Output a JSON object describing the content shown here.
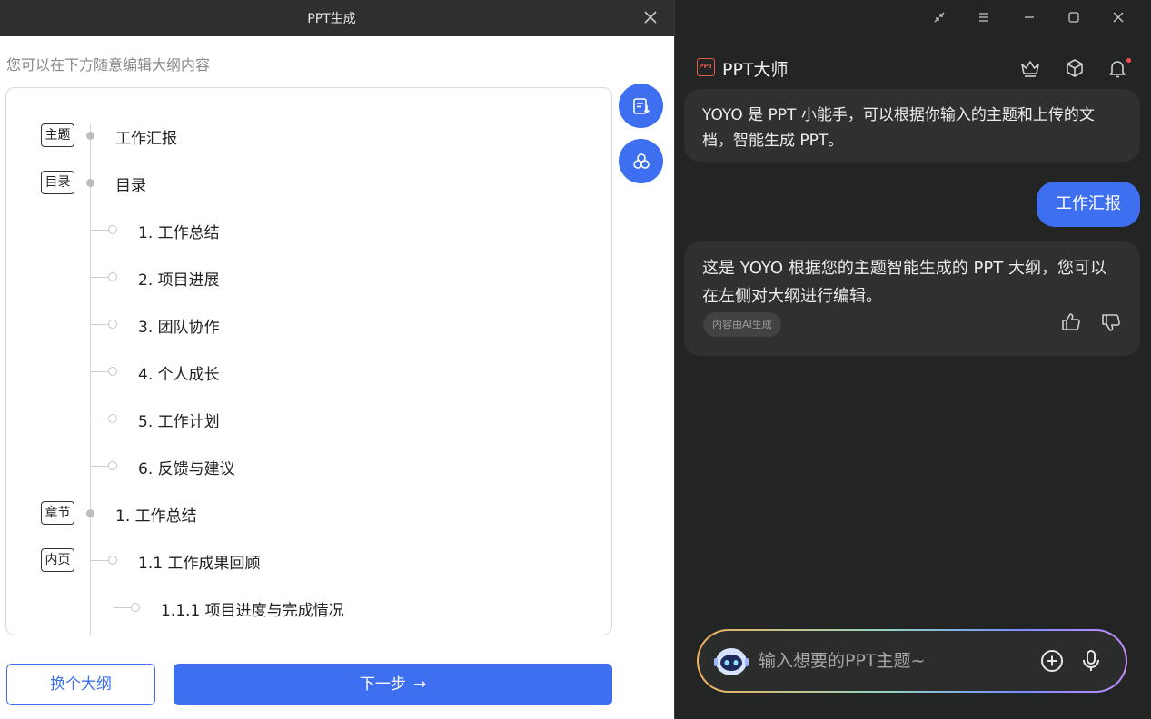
{
  "dialog": {
    "title": "PPT生成",
    "hint": "您可以在下方随意编辑大纲内容",
    "outline": [
      {
        "tag": "主题",
        "text": "工作汇报",
        "level": 0
      },
      {
        "tag": "目录",
        "text": "目录",
        "level": 0
      },
      {
        "tag": "",
        "text": "1. 工作总结",
        "level": 1
      },
      {
        "tag": "",
        "text": "2. 项目进展",
        "level": 1
      },
      {
        "tag": "",
        "text": "3. 团队协作",
        "level": 1
      },
      {
        "tag": "",
        "text": "4. 个人成长",
        "level": 1
      },
      {
        "tag": "",
        "text": "5. 工作计划",
        "level": 1
      },
      {
        "tag": "",
        "text": "6. 反馈与建议",
        "level": 1
      },
      {
        "tag": "章节",
        "text": "1. 工作总结",
        "level": 0
      },
      {
        "tag": "内页",
        "text": "1.1 工作成果回顾",
        "level": 1
      },
      {
        "tag": "",
        "text": "1.1.1 项目进度与完成情况",
        "level": 2
      }
    ],
    "change_button": "换个大纲",
    "next_button": "下一步",
    "next_arrow": "→",
    "accent_color": "#3d6ff0"
  },
  "assistant": {
    "app_name": "PPT大师",
    "logo_text": "PPT",
    "messages": {
      "intro": "YOYO 是 PPT 小能手，可以根据你输入的主题和上传的文档，智能生成 PPT。",
      "user": "工作汇报",
      "reply": "这是 YOYO 根据您的主题智能生成的 PPT 大纲，您可以在左侧对大纲进行编辑。",
      "ai_badge": "内容由AI生成"
    },
    "input": {
      "placeholder": "输入想要的PPT主题~",
      "value": ""
    }
  }
}
